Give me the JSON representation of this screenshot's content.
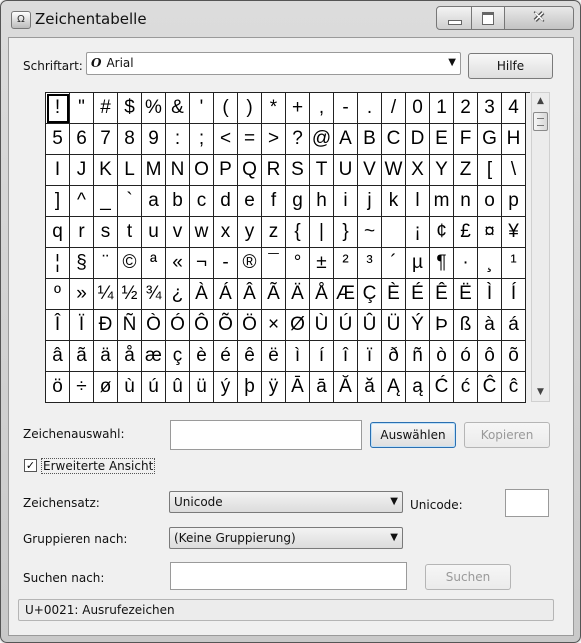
{
  "window": {
    "title": "Zeichentabelle",
    "close_glyph": "✕"
  },
  "font": {
    "label": "Schriftart:",
    "selected": "Arial",
    "font_icon": "O"
  },
  "help_button": "Hilfe",
  "grid": [
    [
      "!",
      "\"",
      "#",
      "$",
      "%",
      "&",
      "'",
      "(",
      ")",
      "*",
      "+",
      ",",
      "-",
      ".",
      "/",
      "0",
      "1",
      "2",
      "3",
      "4"
    ],
    [
      "5",
      "6",
      "7",
      "8",
      "9",
      ":",
      ";",
      "<",
      "=",
      ">",
      "?",
      "@",
      "A",
      "B",
      "C",
      "D",
      "E",
      "F",
      "G",
      "H"
    ],
    [
      "I",
      "J",
      "K",
      "L",
      "M",
      "N",
      "O",
      "P",
      "Q",
      "R",
      "S",
      "T",
      "U",
      "V",
      "W",
      "X",
      "Y",
      "Z",
      "[",
      "\\"
    ],
    [
      "]",
      "^",
      "_",
      "`",
      "a",
      "b",
      "c",
      "d",
      "e",
      "f",
      "g",
      "h",
      "i",
      "j",
      "k",
      "l",
      "m",
      "n",
      "o",
      "p"
    ],
    [
      "q",
      "r",
      "s",
      "t",
      "u",
      "v",
      "w",
      "x",
      "y",
      "z",
      "{",
      "|",
      "}",
      "~",
      " ",
      "¡",
      "¢",
      "£",
      "¤",
      "¥"
    ],
    [
      "¦",
      "§",
      "¨",
      "©",
      "ª",
      "«",
      "¬",
      "-",
      "®",
      "¯",
      "°",
      "±",
      "²",
      "³",
      "´",
      "µ",
      "¶",
      "·",
      "¸",
      "¹"
    ],
    [
      "º",
      "»",
      "¼",
      "½",
      "¾",
      "¿",
      "À",
      "Á",
      "Â",
      "Ã",
      "Ä",
      "Å",
      "Æ",
      "Ç",
      "È",
      "É",
      "Ê",
      "Ë",
      "Ì",
      "Í"
    ],
    [
      "Î",
      "Ï",
      "Ð",
      "Ñ",
      "Ò",
      "Ó",
      "Ô",
      "Õ",
      "Ö",
      "×",
      "Ø",
      "Ù",
      "Ú",
      "Û",
      "Ü",
      "Ý",
      "Þ",
      "ß",
      "à",
      "á"
    ],
    [
      "â",
      "ã",
      "ä",
      "å",
      "æ",
      "ç",
      "è",
      "é",
      "ê",
      "ë",
      "ì",
      "í",
      "î",
      "ï",
      "ð",
      "ñ",
      "ò",
      "ó",
      "ô",
      "õ"
    ],
    [
      "ö",
      "÷",
      "ø",
      "ù",
      "ú",
      "û",
      "ü",
      "ý",
      "þ",
      "ÿ",
      "Ā",
      "ā",
      "Ă",
      "ă",
      "Ą",
      "ą",
      "Ć",
      "ć",
      "Ĉ",
      "ĉ"
    ]
  ],
  "selection": {
    "label": "Zeichenauswahl:",
    "value": "",
    "select_button": "Auswählen",
    "copy_button": "Kopieren"
  },
  "advanced_view": {
    "label": "Erweiterte Ansicht",
    "checked": true,
    "check_glyph": "✓"
  },
  "charset": {
    "label": "Zeichensatz:",
    "selected": "Unicode"
  },
  "unicode": {
    "label": "Unicode:",
    "value": ""
  },
  "group_by": {
    "label": "Gruppieren nach:",
    "selected": "(Keine Gruppierung)"
  },
  "search": {
    "label": "Suchen nach:",
    "value": "",
    "button": "Suchen"
  },
  "status": "U+0021: Ausrufezeichen"
}
